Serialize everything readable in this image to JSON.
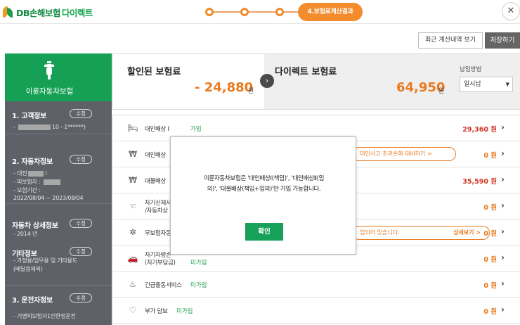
{
  "header": {
    "logo_text": "DB손해보험",
    "logo_sub": "다이렉트",
    "current_step": "4.보험료계산결과",
    "close_icon": "close-icon"
  },
  "actions": {
    "recent": "최근 계산내역 보기",
    "save": "저장하기"
  },
  "sidebar": {
    "title": "이륜자동차보험",
    "icon": "scooter-icon",
    "edit_label": "수정",
    "s1": {
      "heading": "1. 고객정보",
      "line1": "- ",
      "line1b": "10 - 1******)"
    },
    "s2": {
      "heading": "2. 자동차정보",
      "line1": "- 대전",
      "line1b": "l",
      "line2": "- 피보험자 : ",
      "line3": "- 보험기간 :",
      "line4": "2022/08/04 ~ 2023/08/04"
    },
    "s3": {
      "heading": "자동차 상세정보",
      "line1": "- 2014 년"
    },
    "s4": {
      "heading": "기타정보",
      "line1": "- 가정용/업무용 및 기타용도",
      "line2": "(배달용제외)"
    },
    "s5": {
      "heading": "3. 운전자정보",
      "line1": "- 기명피보험자1인한정운전"
    }
  },
  "summary": {
    "discount_label": "할인된 보험료",
    "discount_value": "- 24,880",
    "direct_label": "다이렉트 보험료",
    "direct_value": "64,950",
    "unit": "원",
    "payment_label": "납입방법",
    "payment_value": "일시납"
  },
  "rows": [
    {
      "name": "대인배상 I",
      "status": "가입",
      "amount": "29,360 원",
      "icon": "bed-icon"
    },
    {
      "name": "대인배상",
      "pill": "대인사고 초과손해 대비하기 >",
      "amount": "0 원",
      "icon": "coin-icon"
    },
    {
      "name": "대물배상",
      "amount": "35,590 원",
      "icon": "money-bag-icon"
    },
    {
      "name": "자기신체사",
      "name2": "/자동차상",
      "amount": "0 원",
      "icon": "hand-icon"
    },
    {
      "name": "무보험자동",
      "pill": "입되어 있습니다.",
      "pill_link": "상세보기 >",
      "amount": "0 원",
      "icon": "car-crash-icon"
    },
    {
      "name": "자기차량손",
      "name2": "(자기부담금)",
      "status": "미가입",
      "amount": "0 원",
      "icon": "car-icon"
    },
    {
      "name": "긴급출동서비스",
      "status": "미가입",
      "amount": "0 원",
      "icon": "siren-icon"
    },
    {
      "name": "부가 담보",
      "status": "미가입",
      "amount": "0 원",
      "icon": "heart-icon"
    }
  ],
  "modal": {
    "line1": "이륜자동차보험은 '대인배상Ⅰ(책임)', '대인배상Ⅱ(임",
    "line2": "의)', '대물배상(책임+임의)'만 가입 가능합니다.",
    "ok": "확인"
  },
  "colors": {
    "accent_green": "#16a05a",
    "accent_orange": "#e97a1e",
    "sidebar_bg": "#5f6168"
  }
}
